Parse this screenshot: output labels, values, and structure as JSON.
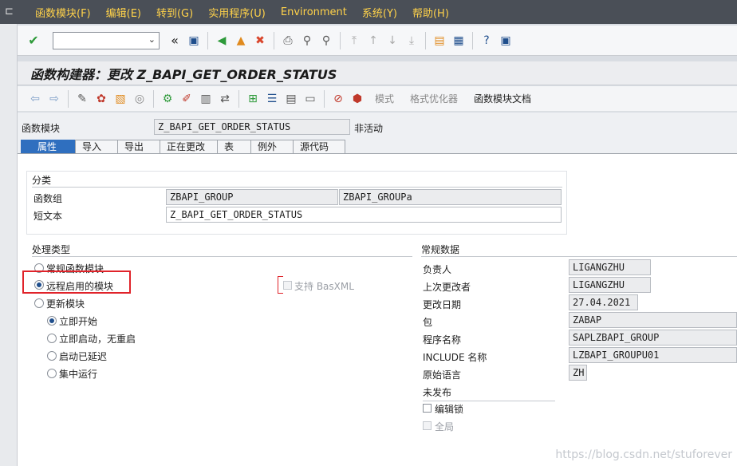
{
  "menu": {
    "items": [
      "函数模块(F)",
      "编辑(E)",
      "转到(G)",
      "实用程序(U)",
      "Environment",
      "系统(Y)",
      "帮助(H)"
    ]
  },
  "toolbar": {
    "command_value": "",
    "back_glyph": "«"
  },
  "title": "函数构建器：更改 Z_BAPI_GET_ORDER_STATUS",
  "app_toolbar": {
    "pattern": "模式",
    "pretty_printer": "格式优化器",
    "docs": "函数模块文档"
  },
  "header": {
    "fm_label": "函数模块",
    "fm_value": "Z_BAPI_GET_ORDER_STATUS",
    "status": "非活动"
  },
  "tabs": [
    "属性",
    "导入",
    "导出",
    "正在更改",
    "表",
    "例外",
    "源代码"
  ],
  "classification": {
    "title": "分类",
    "group_label": "函数组",
    "group_value": "ZBAPI_GROUP",
    "group_desc": "ZBAPI_GROUPa",
    "short_label": "短文本",
    "short_value": "Z_BAPI_GET_ORDER_STATUS"
  },
  "processing": {
    "title": "处理类型",
    "normal": "常规函数模块",
    "remote": "远程启用的模块",
    "basxml": "支持 BasXML",
    "update": "更新模块",
    "immediate": "立即开始",
    "immediate_norestart": "立即启动，无重启",
    "delayed": "启动已延迟",
    "collective": "集中运行"
  },
  "general": {
    "title": "常规数据",
    "responsible_label": "负责人",
    "responsible_value": "LIGANGZHU",
    "last_changed_label": "上次更改者",
    "last_changed_value": "LIGANGZHU",
    "change_date_label": "更改日期",
    "change_date_value": "27.04.2021",
    "package_label": "包",
    "package_value": "ZABAP",
    "program_label": "程序名称",
    "program_value": "SAPLZBAPI_GROUP",
    "include_label": "INCLUDE 名称",
    "include_value": "LZBAPI_GROUPU01",
    "lang_label": "原始语言",
    "lang_value": "ZH",
    "unreleased": "未发布",
    "edit_lock": "编辑锁",
    "global": "全局"
  },
  "watermark": "https://blog.csdn.net/stuforever",
  "colors": {
    "menubar": "#4a4f57",
    "menu_text": "#ffd24a",
    "tab_active": "#2f6fbf",
    "highlight": "#e0232a"
  }
}
